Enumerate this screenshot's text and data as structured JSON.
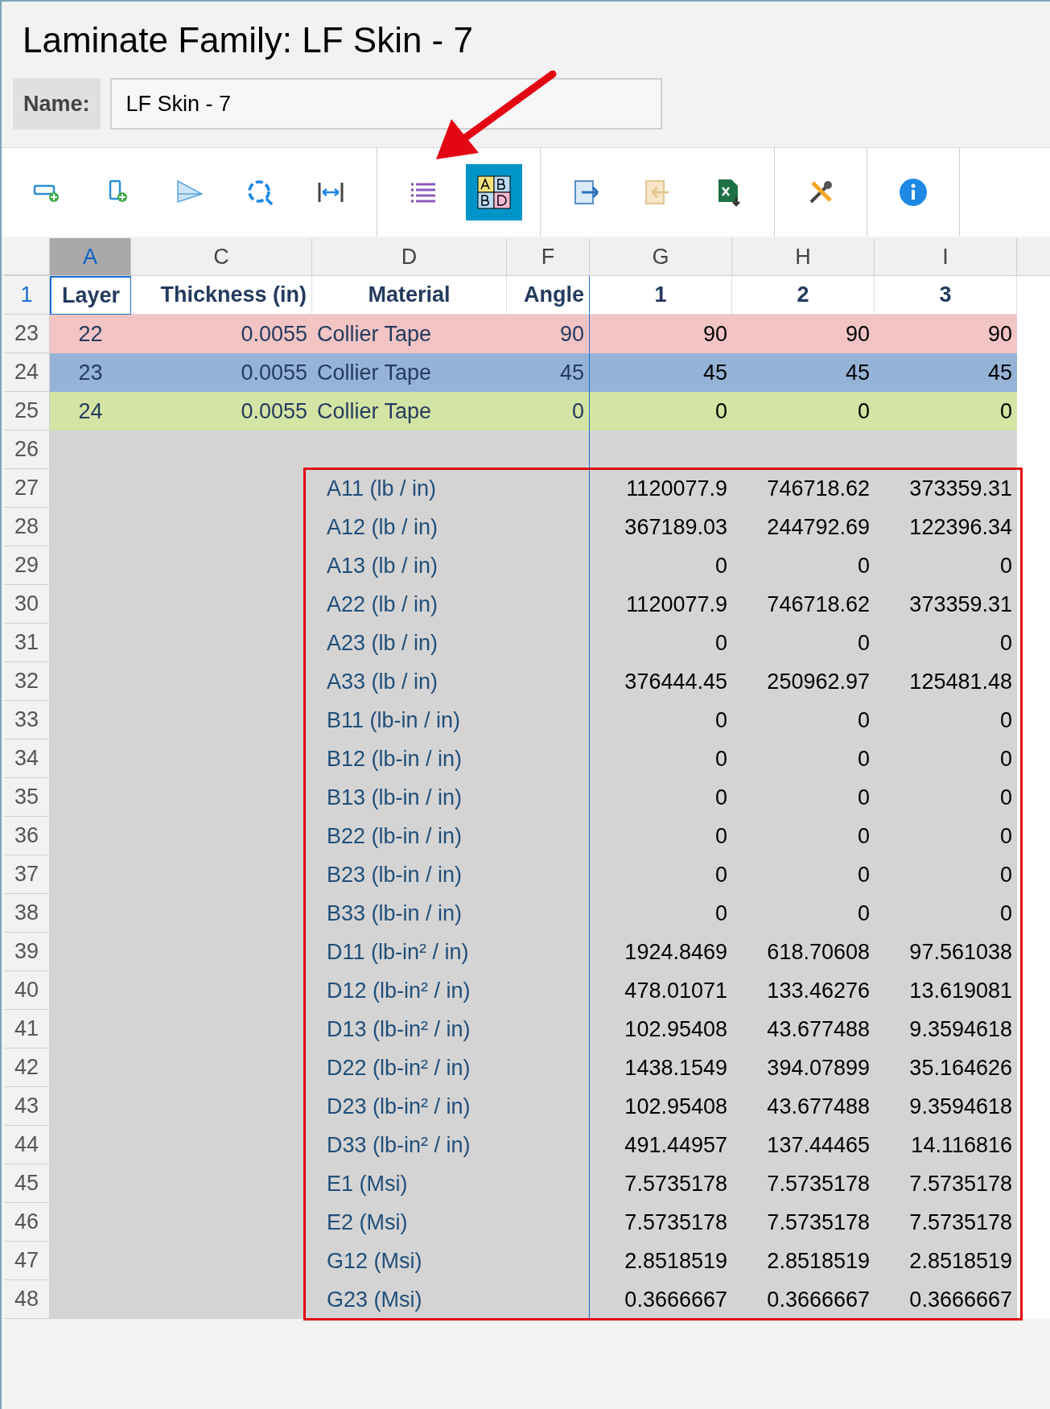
{
  "window": {
    "title": "Laminate Family: LF Skin - 7"
  },
  "name_field": {
    "label": "Name:",
    "value": "LF Skin - 7"
  },
  "toolbar": [
    [
      {
        "kind": "add-row",
        "selected": false
      },
      {
        "kind": "add-doc",
        "selected": false
      },
      {
        "kind": "plane",
        "selected": false
      },
      {
        "kind": "refresh",
        "selected": false
      },
      {
        "kind": "width",
        "selected": false
      }
    ],
    [
      {
        "kind": "list",
        "selected": false
      },
      {
        "kind": "abd",
        "selected": true
      }
    ],
    [
      {
        "kind": "export",
        "selected": false
      },
      {
        "kind": "import",
        "selected": false
      },
      {
        "kind": "excel",
        "selected": false
      }
    ],
    [
      {
        "kind": "tools",
        "selected": false
      }
    ],
    [
      {
        "kind": "info",
        "selected": false
      }
    ]
  ],
  "columns": [
    {
      "label": "A",
      "selected": true
    },
    {
      "label": "C",
      "selected": false
    },
    {
      "label": "D",
      "selected": false
    },
    {
      "label": "F",
      "selected": false
    },
    {
      "label": "G",
      "selected": false
    },
    {
      "label": "H",
      "selected": false
    },
    {
      "label": "I",
      "selected": false
    }
  ],
  "header_row": {
    "number": "1",
    "selected": true,
    "cells": [
      "Layer",
      "Thickness (in)",
      "Material",
      "Angle",
      "1",
      "2",
      "3"
    ]
  },
  "layer_rows": [
    {
      "number": "23",
      "color": "#f2c4c4",
      "layer": "22",
      "thickness": "0.0055",
      "material": "Collier Tape",
      "angle": "90",
      "values": [
        "90",
        "90",
        "90"
      ]
    },
    {
      "number": "24",
      "color": "#95b3d7",
      "layer": "23",
      "thickness": "0.0055",
      "material": "Collier Tape",
      "angle": "45",
      "values": [
        "45",
        "45",
        "45"
      ]
    },
    {
      "number": "25",
      "color": "#d4e4a4",
      "layer": "24",
      "thickness": "0.0055",
      "material": "Collier Tape",
      "angle": "0",
      "values": [
        "0",
        "0",
        "0"
      ]
    }
  ],
  "blank_row": {
    "number": "26"
  },
  "property_rows": [
    {
      "number": "27",
      "label": "A11 (lb / in)",
      "values": [
        "1120077.9",
        "746718.62",
        "373359.31"
      ]
    },
    {
      "number": "28",
      "label": "A12 (lb / in)",
      "values": [
        "367189.03",
        "244792.69",
        "122396.34"
      ]
    },
    {
      "number": "29",
      "label": "A13 (lb / in)",
      "values": [
        "0",
        "0",
        "0"
      ]
    },
    {
      "number": "30",
      "label": "A22 (lb / in)",
      "values": [
        "1120077.9",
        "746718.62",
        "373359.31"
      ]
    },
    {
      "number": "31",
      "label": "A23 (lb / in)",
      "values": [
        "0",
        "0",
        "0"
      ]
    },
    {
      "number": "32",
      "label": "A33 (lb / in)",
      "values": [
        "376444.45",
        "250962.97",
        "125481.48"
      ]
    },
    {
      "number": "33",
      "label": "B11 (lb-in / in)",
      "values": [
        "0",
        "0",
        "0"
      ]
    },
    {
      "number": "34",
      "label": "B12 (lb-in / in)",
      "values": [
        "0",
        "0",
        "0"
      ]
    },
    {
      "number": "35",
      "label": "B13 (lb-in / in)",
      "values": [
        "0",
        "0",
        "0"
      ]
    },
    {
      "number": "36",
      "label": "B22 (lb-in / in)",
      "values": [
        "0",
        "0",
        "0"
      ]
    },
    {
      "number": "37",
      "label": "B23 (lb-in / in)",
      "values": [
        "0",
        "0",
        "0"
      ]
    },
    {
      "number": "38",
      "label": "B33 (lb-in / in)",
      "values": [
        "0",
        "0",
        "0"
      ]
    },
    {
      "number": "39",
      "label": "D11 (lb-in² / in)",
      "values": [
        "1924.8469",
        "618.70608",
        "97.561038"
      ]
    },
    {
      "number": "40",
      "label": "D12 (lb-in² / in)",
      "values": [
        "478.01071",
        "133.46276",
        "13.619081"
      ]
    },
    {
      "number": "41",
      "label": "D13 (lb-in² / in)",
      "values": [
        "102.95408",
        "43.677488",
        "9.3594618"
      ]
    },
    {
      "number": "42",
      "label": "D22 (lb-in² / in)",
      "values": [
        "1438.1549",
        "394.07899",
        "35.164626"
      ]
    },
    {
      "number": "43",
      "label": "D23 (lb-in² / in)",
      "values": [
        "102.95408",
        "43.677488",
        "9.3594618"
      ]
    },
    {
      "number": "44",
      "label": "D33 (lb-in² / in)",
      "values": [
        "491.44957",
        "137.44465",
        "14.116816"
      ]
    },
    {
      "number": "45",
      "label": "E1 (Msi)",
      "values": [
        "7.5735178",
        "7.5735178",
        "7.5735178"
      ]
    },
    {
      "number": "46",
      "label": "E2 (Msi)",
      "values": [
        "7.5735178",
        "7.5735178",
        "7.5735178"
      ]
    },
    {
      "number": "47",
      "label": "G12 (Msi)",
      "values": [
        "2.8518519",
        "2.8518519",
        "2.8518519"
      ]
    },
    {
      "number": "48",
      "label": "G23 (Msi)",
      "values": [
        "0.3666667",
        "0.3666667",
        "0.3666667"
      ]
    }
  ]
}
